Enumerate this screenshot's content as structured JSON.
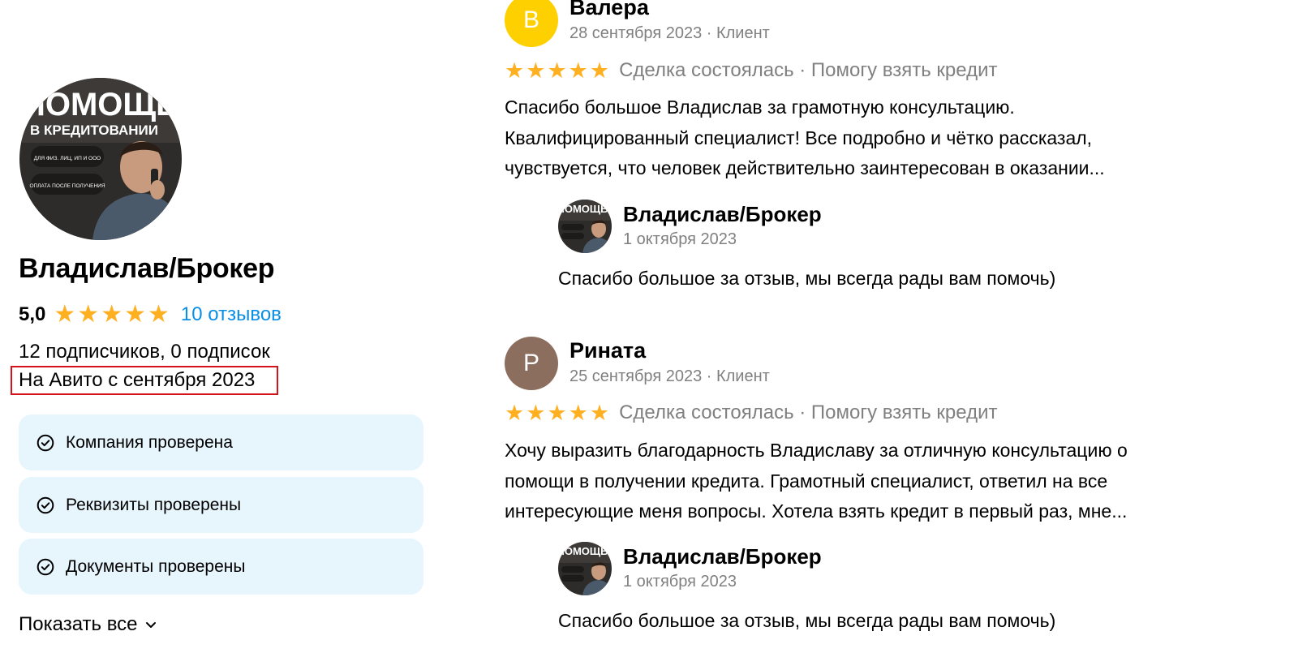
{
  "profile": {
    "name": "Владислав/Брокер",
    "rating": "5,0",
    "reviews_link": "10 отзывов",
    "followers": "12 подписчиков, 0 подписок",
    "since": "На Авито с сентября 2023",
    "avatar_banner": {
      "title": "ПОМОЩЬ",
      "subtitle": "В КРЕДИТОВАНИИ",
      "pill_1": "ДЛЯ ФИЗ. ЛИЦ, ИП И ООО",
      "pill_2": "ОПЛАТА ПОСЛЕ ПОЛУЧЕНИЯ"
    },
    "verifications": [
      {
        "label": "Компания проверена",
        "icon": "check-circle-icon"
      },
      {
        "label": "Реквизиты проверены",
        "icon": "check-circle-icon"
      },
      {
        "label": "Документы проверены",
        "icon": "check-circle-icon"
      }
    ],
    "show_all": "Показать все"
  },
  "reviews": [
    {
      "author": "Валера",
      "initial": "В",
      "avatar_color": "#ffd000",
      "meta": "28 сентября 2023 · Клиент",
      "stars": 5,
      "tags": "Сделка состоялась · Помогу взять кредит",
      "text_lines": [
        "Спасибо большое Владислав за грамотную консультацию.",
        "Квалифицированный специалист! Все подробно и чётко рассказал,",
        "чувствуется, что человек действительно заинтересован в оказании..."
      ],
      "reply": {
        "author": "Владислав/Брокер",
        "date": "1 октября 2023",
        "text": "Спасибо большое за отзыв, мы всегда рады вам помочь)"
      }
    },
    {
      "author": "Рината",
      "initial": "Р",
      "avatar_color": "#8c6e5f",
      "meta": "25 сентября 2023 · Клиент",
      "stars": 5,
      "tags": "Сделка состоялась · Помогу взять кредит",
      "text_lines": [
        "Хочу выразить благодарность Владиславу за отличную консультацию о",
        "помощи в получении кредита. Грамотный специалист, ответил на все",
        "интересующие меня вопросы. Хотела взять кредит в первый раз, мне..."
      ],
      "reply": {
        "author": "Владислав/Брокер",
        "date": "1 октября 2023",
        "text": "Спасибо большое за отзыв, мы всегда рады вам помочь)"
      }
    }
  ],
  "colors": {
    "star": "#ffb021",
    "link": "#0a8ee6",
    "verify_bg": "#e7f5fd",
    "highlight_border": "#d6121b",
    "muted_text": "#808080"
  }
}
